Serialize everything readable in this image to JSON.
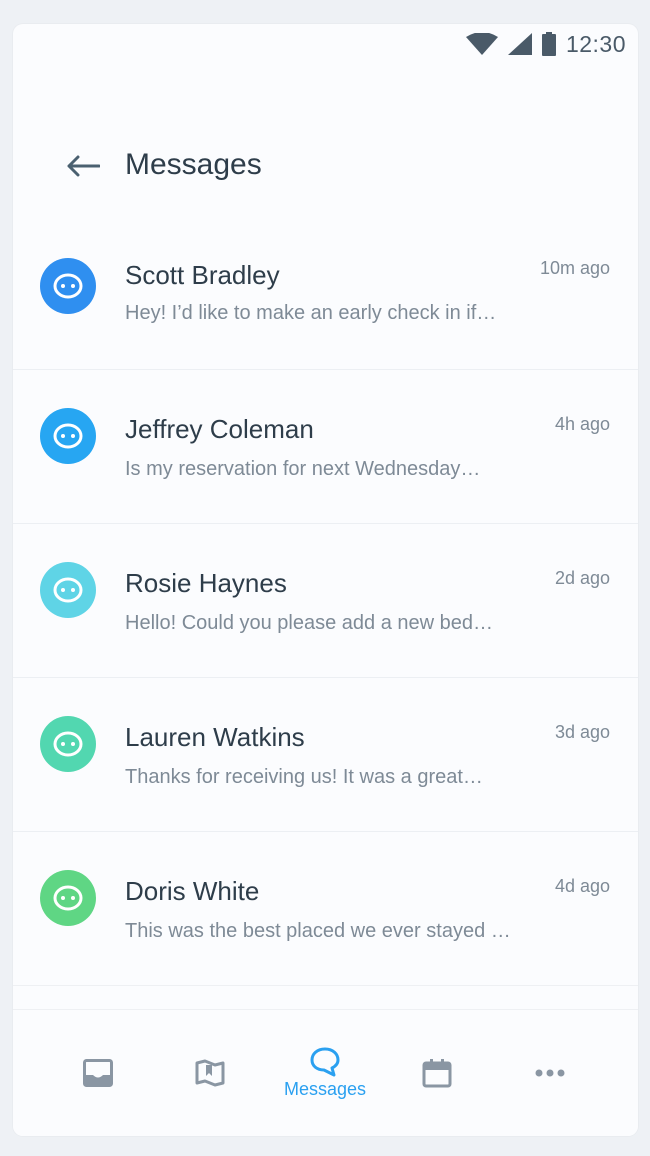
{
  "status_bar": {
    "time": "12:30",
    "icons": [
      "wifi-icon",
      "signal-icon",
      "battery-icon"
    ]
  },
  "app_bar": {
    "title": "Messages",
    "back_icon": "arrow-left-icon"
  },
  "conversations": [
    {
      "name": "Scott Bradley",
      "preview": "Hey! I’d like to make an early check in if…",
      "time": "10m ago",
      "avatar_color": "#2f8ff0"
    },
    {
      "name": "Jeffrey Coleman",
      "preview": "Is my reservation for next Wednesday…",
      "time": "4h ago",
      "avatar_color": "#27a6f2"
    },
    {
      "name": "Rosie Haynes",
      "preview": "Hello! Could you please add a new bed…",
      "time": "2d ago",
      "avatar_color": "#5fd4e6"
    },
    {
      "name": "Lauren Watkins",
      "preview": "Thanks for receiving us! It was a great…",
      "time": "3d ago",
      "avatar_color": "#52d7b0"
    },
    {
      "name": "Doris White",
      "preview": "This was the best placed we ever stayed …",
      "time": "4d ago",
      "avatar_color": "#5fd684"
    }
  ],
  "tab_bar": {
    "tabs": [
      {
        "icon": "inbox-icon",
        "label": "",
        "active": false
      },
      {
        "icon": "map-icon",
        "label": "",
        "active": false
      },
      {
        "icon": "chat-bubble-icon",
        "label": "Messages",
        "active": true
      },
      {
        "icon": "calendar-icon",
        "label": "",
        "active": false
      },
      {
        "icon": "more-icon",
        "label": "",
        "active": false
      }
    ],
    "active_color": "#2aa0f0",
    "inactive_color": "#8a96a3"
  }
}
